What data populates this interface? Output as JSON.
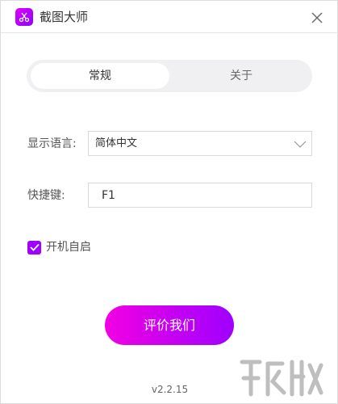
{
  "window": {
    "title": "截图大师"
  },
  "tabs": [
    {
      "label": "常规",
      "active": true
    },
    {
      "label": "关于",
      "active": false
    }
  ],
  "settings": {
    "language_label": "显示语言:",
    "language_value": "简体中文",
    "hotkey_label": "快捷键:",
    "hotkey_value": "F1",
    "autostart_label": "开机自启",
    "autostart_checked": true
  },
  "actions": {
    "rate_label": "评价我们"
  },
  "footer": {
    "version": "v2.2.15"
  },
  "icons": {
    "app": "scissors-icon",
    "close": "close-icon",
    "dropdown": "chevron-down-icon",
    "checkbox": "check-icon"
  },
  "colors": {
    "accent_start": "#f200e2",
    "accent_end": "#9f00ff",
    "checkbox": "#a000ff"
  }
}
